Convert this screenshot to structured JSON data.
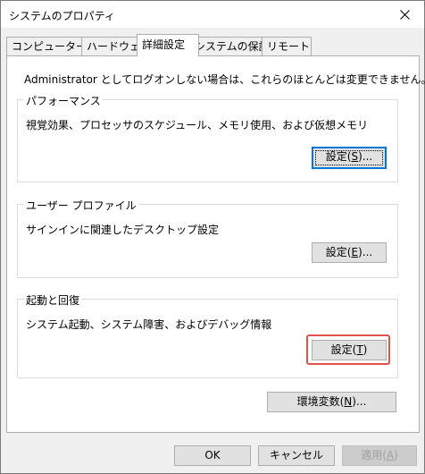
{
  "window": {
    "title": "システムのプロパティ",
    "close_icon": "close-icon"
  },
  "tabs": [
    {
      "label": "コンピューター名"
    },
    {
      "label": "ハードウェア"
    },
    {
      "label": "詳細設定"
    },
    {
      "label": "システムの保護"
    },
    {
      "label": "リモート"
    }
  ],
  "active_tab": "詳細設定",
  "intro": "Administrator としてログオンしない場合は、これらのほとんどは変更できません。",
  "performance": {
    "title": "パフォーマンス",
    "description": "視覚効果、プロセッサのスケジュール、メモリ使用、および仮想メモリ",
    "button": {
      "prefix": "設定(",
      "key": "S",
      "suffix": ")..."
    }
  },
  "profile": {
    "title": "ユーザー プロファイル",
    "description": "サインインに関連したデスクトップ設定",
    "button": {
      "prefix": "設定(",
      "key": "E",
      "suffix": ")..."
    }
  },
  "startup": {
    "title": "起動と回復",
    "description": "システム起動、システム障害、およびデバッグ情報",
    "button": {
      "prefix": "設定(",
      "key": "T",
      "suffix": ")"
    }
  },
  "env_button": {
    "prefix": "環境変数(",
    "key": "N",
    "suffix": ")..."
  },
  "footer": {
    "ok": "OK",
    "cancel": "キャンセル",
    "apply": {
      "prefix": "適用(",
      "key": "A",
      "suffix": ")"
    }
  },
  "colors": {
    "highlight": "#e0524a",
    "focus": "#0078d7"
  }
}
